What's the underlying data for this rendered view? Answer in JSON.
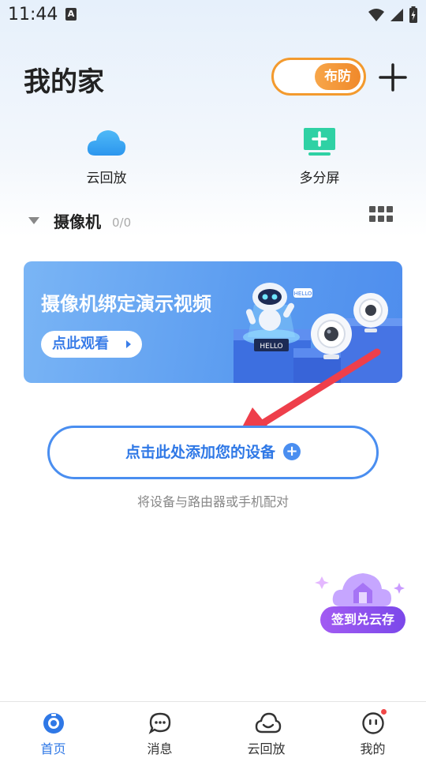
{
  "status_bar": {
    "time": "11:44",
    "notification_icon": "A"
  },
  "header": {
    "title": "我的家",
    "arm_button": "布防"
  },
  "quick_actions": [
    {
      "label": "云回放",
      "icon": "cloud-icon"
    },
    {
      "label": "多分屏",
      "icon": "multi-screen-icon"
    }
  ],
  "camera_section": {
    "title": "摄像机",
    "count": "0/0"
  },
  "banner": {
    "title": "摄像机绑定演示视频",
    "button": "点此观看",
    "art_hello_1": "HELLO",
    "art_hello_2": "HELLO"
  },
  "add_device": {
    "label": "点击此处添加您的设备",
    "hint": "将设备与路由器或手机配对"
  },
  "float_badge": {
    "label": "签到兑云存"
  },
  "bottom_nav": [
    {
      "label": "首页",
      "active": true
    },
    {
      "label": "消息",
      "active": false
    },
    {
      "label": "云回放",
      "active": false
    },
    {
      "label": "我的",
      "active": false
    }
  ],
  "colors": {
    "accent": "#2f78e6",
    "arm": "#f39a2e",
    "arrow": "#ee3f4b",
    "badge": "#8a4fee"
  }
}
